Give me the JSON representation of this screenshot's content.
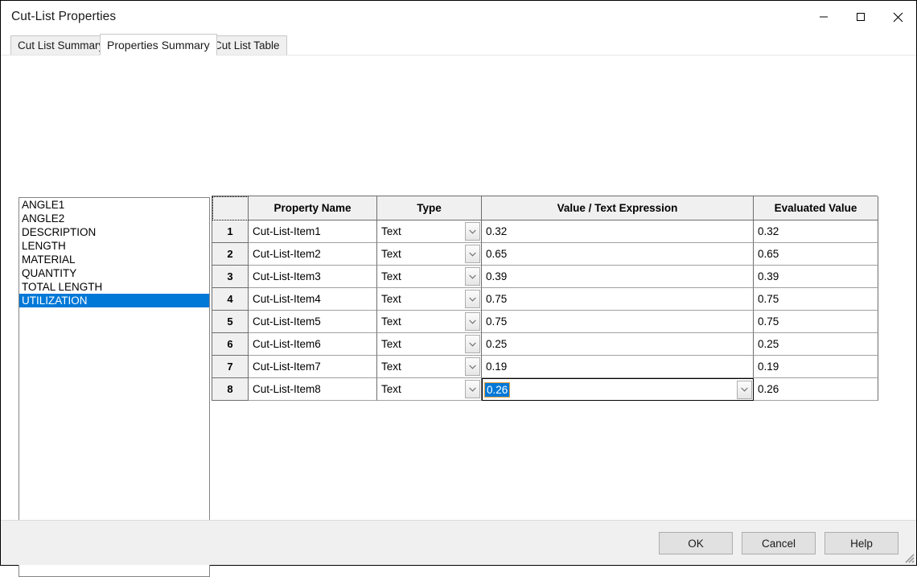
{
  "window": {
    "title": "Cut-List Properties",
    "controls": [
      {
        "name": "minimize",
        "label": "Minimize"
      },
      {
        "name": "maximize",
        "label": "Maximize"
      },
      {
        "name": "close",
        "label": "Close"
      }
    ]
  },
  "tabs": [
    {
      "label": "Cut List Summary",
      "active": false
    },
    {
      "label": "Properties Summary",
      "active": true
    },
    {
      "label": "Cut List Table",
      "active": false
    }
  ],
  "property_list": {
    "items": [
      {
        "label": "ANGLE1",
        "selected": false
      },
      {
        "label": "ANGLE2",
        "selected": false
      },
      {
        "label": "DESCRIPTION",
        "selected": false
      },
      {
        "label": "LENGTH",
        "selected": false
      },
      {
        "label": "MATERIAL",
        "selected": false
      },
      {
        "label": "QUANTITY",
        "selected": false
      },
      {
        "label": "TOTAL LENGTH",
        "selected": false
      },
      {
        "label": "UTILIZATION",
        "selected": true
      }
    ],
    "selection_color": "#0078d7"
  },
  "grid": {
    "columns": [
      {
        "key": "rownum",
        "label": ""
      },
      {
        "key": "name",
        "label": "Property Name"
      },
      {
        "key": "type",
        "label": "Type"
      },
      {
        "key": "value",
        "label": "Value / Text Expression"
      },
      {
        "key": "evaluated",
        "label": "Evaluated Value"
      }
    ],
    "rows": [
      {
        "rownum": "1",
        "name": "Cut-List-Item1",
        "type": "Text",
        "value": "0.32",
        "evaluated": "0.32",
        "editing": false
      },
      {
        "rownum": "2",
        "name": "Cut-List-Item2",
        "type": "Text",
        "value": "0.65",
        "evaluated": "0.65",
        "editing": false
      },
      {
        "rownum": "3",
        "name": "Cut-List-Item3",
        "type": "Text",
        "value": "0.39",
        "evaluated": "0.39",
        "editing": false
      },
      {
        "rownum": "4",
        "name": "Cut-List-Item4",
        "type": "Text",
        "value": "0.75",
        "evaluated": "0.75",
        "editing": false
      },
      {
        "rownum": "5",
        "name": "Cut-List-Item5",
        "type": "Text",
        "value": "0.75",
        "evaluated": "0.75",
        "editing": false
      },
      {
        "rownum": "6",
        "name": "Cut-List-Item6",
        "type": "Text",
        "value": "0.25",
        "evaluated": "0.25",
        "editing": false
      },
      {
        "rownum": "7",
        "name": "Cut-List-Item7",
        "type": "Text",
        "value": "0.19",
        "evaluated": "0.19",
        "editing": false
      },
      {
        "rownum": "8",
        "name": "Cut-List-Item8",
        "type": "Text",
        "value": "0.26",
        "evaluated": "0.26",
        "editing": true
      }
    ],
    "header_bg": "#f0f0f0",
    "edit_selection_color": "#0078d7"
  },
  "footer": {
    "buttons": [
      {
        "name": "ok",
        "label": "OK"
      },
      {
        "name": "cancel",
        "label": "Cancel"
      },
      {
        "name": "help",
        "label": "Help"
      }
    ]
  }
}
